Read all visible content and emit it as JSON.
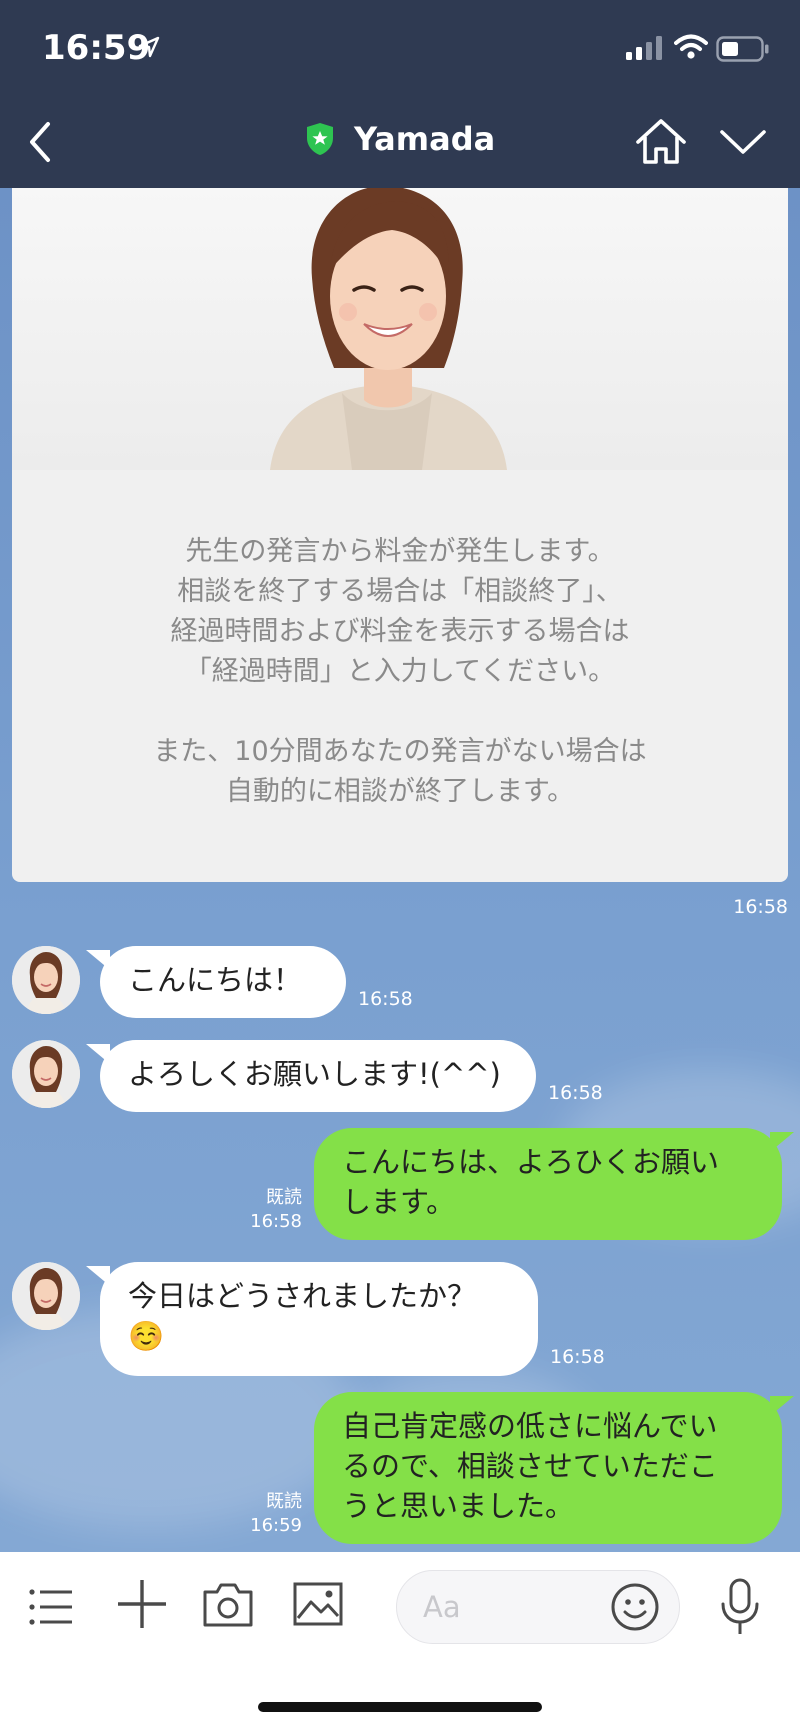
{
  "status_bar": {
    "time": "16:59"
  },
  "header": {
    "title": "Yamada"
  },
  "intro": {
    "lines": [
      "先生の発言から料金が発生します。",
      "相談を終了する場合は「相談終了」、",
      "経過時間および料金を表示する場合は",
      "「経過時間」と入力してください。",
      "",
      "また、10分間あなたの発言がない場合は",
      "自動的に相談が終了します。"
    ],
    "time": "16:58"
  },
  "messages": [
    {
      "side": "in",
      "text": "こんにちは！",
      "time": "16:58"
    },
    {
      "side": "in",
      "text": "よろしくお願いします!(^^)",
      "time": "16:58"
    },
    {
      "side": "out",
      "lines": [
        "こんにちは、よろひくお願い",
        "します。"
      ],
      "read": "既読",
      "time": "16:58"
    },
    {
      "side": "in",
      "lines": [
        "今日はどうされましたか？",
        "☺️"
      ],
      "time": "16:58"
    },
    {
      "side": "out",
      "lines": [
        "自己肯定感の低さに悩んでい",
        "るので、相談させていただこ",
        "うと思いました。"
      ],
      "read": "既読",
      "time": "16:59"
    }
  ],
  "input": {
    "placeholder": "Aa"
  },
  "icons": {
    "menu": "menu-icon",
    "plus": "plus-icon",
    "camera": "camera-icon",
    "image": "image-icon",
    "emoji": "emoji-icon",
    "mic": "mic-icon",
    "home": "home-icon",
    "back": "back-icon",
    "chevron": "chevron-down-icon",
    "shield": "verified-shield-icon"
  },
  "colors": {
    "header_bg": "#2f3a52",
    "bubble_out": "#84e048",
    "bubble_in": "#ffffff",
    "chat_bg": "#7599c9"
  }
}
